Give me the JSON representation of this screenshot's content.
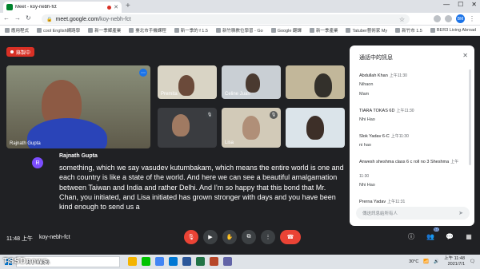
{
  "browser": {
    "tab_title": "Meet - koy-nebh-fct",
    "url_domain": "meet.google.com",
    "url_path": "/koy-nebh-fct",
    "profile_initials": "BM",
    "bookmarks": [
      "應用程式",
      "cool English網路學",
      "新一季鄉產業",
      "臺北市手機課程",
      "新一季的 f 1.5",
      "新竹縣數位學習 - Go",
      "Google 翻譯",
      "新一季產業",
      "Tatuber藝術家 My",
      "新竹市 1.5",
      "BER3 Living Abroad"
    ]
  },
  "recording": {
    "label": "錄製中"
  },
  "tiles": {
    "main": {
      "name": "Rajnath Gupta"
    },
    "t1": {
      "name": "Premita"
    },
    "t2": {
      "name": "Celine Juan"
    },
    "t3": {
      "name": ""
    },
    "t4": {
      "name": ""
    },
    "t5": {
      "name": "Lisa"
    },
    "t6": {
      "name": ""
    }
  },
  "caption": {
    "initial": "R",
    "speaker": "Rajnath Gupta",
    "text": "something, which we say vasudev kutumbakam, which means the entire world is one and each country is like a state of the world. And here we can see a beautiful amalgamation between Taiwan and India and rather Delhi. And I'm so happy that this bond that Mr. Chan, you initiated, and Lisa initiated has grown stronger with days and you have been kind enough to send us a"
  },
  "chat": {
    "title": "通話中的訊息",
    "input_placeholder": "傳送訊息給所有人",
    "messages": [
      {
        "sender": "Abdullah Khan",
        "time": "上午11:30",
        "text": "Nihaon"
      },
      {
        "sender": "",
        "time": "",
        "text": "Mam"
      },
      {
        "sender": "TIARA TOKAS 6D",
        "time": "上午11:30",
        "text": "Nhi Hao"
      },
      {
        "sender": "Slok Yadav 6-C",
        "time": "上午11:30",
        "text": "ni hao"
      },
      {
        "sender": "Anwesh sheshma class 6 c roll no 3 Sheshma",
        "time": "上午11:30",
        "text": "Nhi Hao"
      },
      {
        "sender": "Prerna Yadav",
        "time": "上午11:31",
        "text": "Nhi hao maam"
      }
    ]
  },
  "bottom": {
    "time": "11:48 上午",
    "meeting_code": "koy-nebh-fct",
    "participants_count": "54"
  },
  "taskbar": {
    "search_placeholder": "文字來搜尋",
    "weather": "30°C",
    "time": "上午 11:48",
    "date": "2021/7/1",
    "watermark": "TSSDnews."
  }
}
